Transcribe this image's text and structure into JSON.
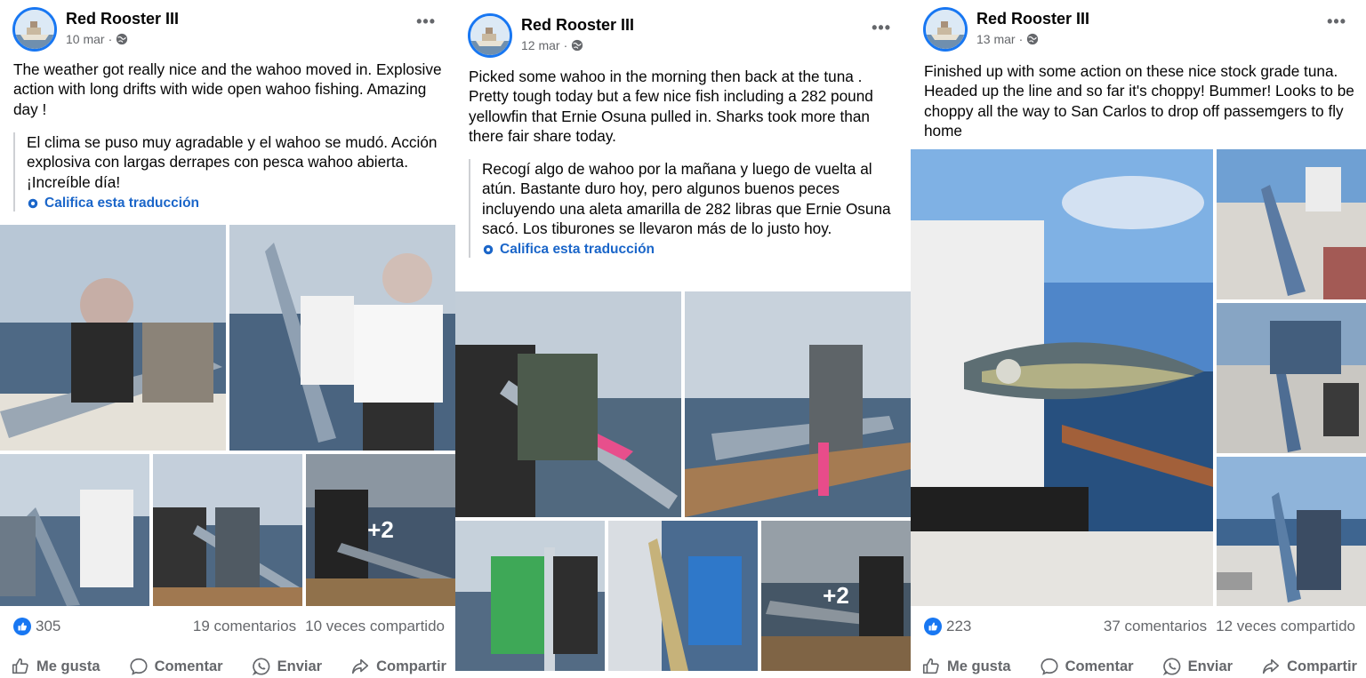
{
  "posts": [
    {
      "page_name": "Red Rooster III",
      "date": "10 mar",
      "meta_sep": "·",
      "more": "•••",
      "text": "The weather got really nice and the wahoo moved in. Explosive action with long drifts with wide open wahoo fishing. Amazing day !",
      "translation": "El clima se puso muy agradable y el wahoo se mudó. Acción explosiva con largas derrapes con pesca wahoo abierta. ¡Increíble día!",
      "rate_translation": "Califica esta traducción",
      "more_photos": "+2",
      "likes": "305",
      "comments": "19 comentarios",
      "shares": "10 veces compartido",
      "actions": {
        "like": "Me gusta",
        "comment": "Comentar",
        "send": "Enviar",
        "share": "Compartir"
      }
    },
    {
      "page_name": "Red Rooster III",
      "date": "12 mar",
      "meta_sep": "·",
      "more": "•••",
      "text": "Picked some wahoo in the morning then back at the tuna . Pretty tough today but a few nice fish including a 282 pound yellowfin that Ernie Osuna pulled in. Sharks took more than there fair share today.",
      "translation": "Recogí algo de wahoo por la mañana y luego de vuelta al atún. Bastante duro hoy, pero algunos buenos peces incluyendo una aleta amarilla de 282 libras que Ernie Osuna sacó. Los tiburones se llevaron más de lo justo hoy.",
      "rate_translation": "Califica esta traducción",
      "more_photos": "+2"
    },
    {
      "page_name": "Red Rooster III",
      "date": "13 mar",
      "meta_sep": "·",
      "more": "•••",
      "text": "Finished up with some action on these nice stock grade tuna. Headed up the line and so far it's choppy! Bummer! Looks to be choppy all the way to San Carlos to drop off passemgers to fly home",
      "likes": "223",
      "comments": "37 comentarios",
      "shares": "12 veces compartido",
      "actions": {
        "like": "Me gusta",
        "comment": "Comentar",
        "send": "Enviar",
        "share": "Compartir"
      }
    }
  ],
  "icons": [
    "boat-avatar",
    "globe-icon",
    "more-icon",
    "gear-icon",
    "like-badge-icon",
    "thumb-up-icon",
    "comment-icon",
    "whatsapp-icon",
    "share-icon"
  ],
  "colors": {
    "facebook_blue": "#1877f2",
    "link_blue": "#1b66c9",
    "secondary_text": "#65676b",
    "primary_text": "#050505"
  }
}
